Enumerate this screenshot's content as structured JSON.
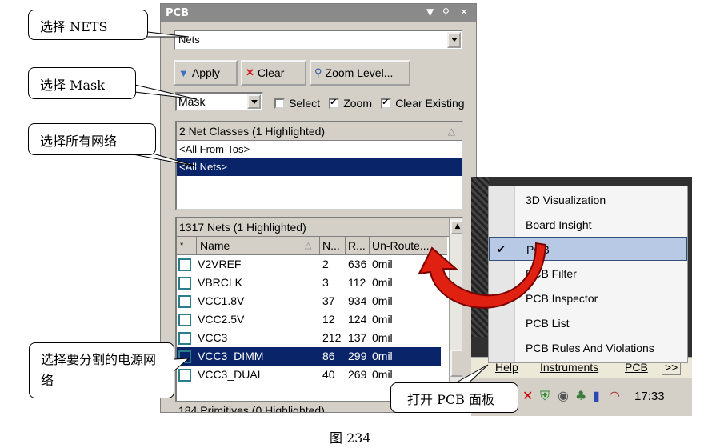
{
  "panel": {
    "title": "PCB",
    "title_controls": [
      "▼",
      "⚲",
      "✕"
    ],
    "scope_value": "Nets",
    "buttons": {
      "apply": "Apply",
      "clear": "Clear",
      "zoom_level": "Zoom Level..."
    },
    "mask_value": "Mask",
    "options": {
      "select": {
        "label": "Select",
        "checked": false
      },
      "zoom": {
        "label": "Zoom",
        "checked": true
      },
      "clear_existing": {
        "label": "Clear Existing",
        "checked": true
      }
    },
    "classes_header": "2 Net Classes (1 Highlighted)",
    "classes": [
      "<All From-Tos>",
      "<All Nets>"
    ],
    "nets_header": "1317 Nets (1 Highlighted)",
    "columns": [
      "*",
      "Name",
      "N...",
      "R...",
      "Un-Route..."
    ],
    "nets": [
      {
        "name": "V2VREF",
        "n": "2",
        "r": "636",
        "unrouted": "0mil"
      },
      {
        "name": "VBRCLK",
        "n": "3",
        "r": "112",
        "unrouted": "0mil"
      },
      {
        "name": "VCC1.8V",
        "n": "37",
        "r": "934",
        "unrouted": "0mil"
      },
      {
        "name": "VCC2.5V",
        "n": "12",
        "r": "124",
        "unrouted": "0mil"
      },
      {
        "name": "VCC3",
        "n": "212",
        "r": "137",
        "unrouted": "0mil"
      },
      {
        "name": "VCC3_DIMM",
        "n": "86",
        "r": "299",
        "unrouted": "0mil"
      },
      {
        "name": "VCC3_DUAL",
        "n": "40",
        "r": "269",
        "unrouted": "0mil"
      }
    ],
    "primitives_header": "184 Primitives (0 Highlighted)"
  },
  "callouts": {
    "nets": "选择 NETS",
    "mask": "选择 Mask",
    "all_nets": "选择所有网络",
    "power_net": "选择要分割的电源网络",
    "open_pcb": "打开 PCB 面板"
  },
  "menu": {
    "items": [
      "3D Visualization",
      "Board Insight",
      "PCB",
      "PCB Filter",
      "PCB Inspector",
      "PCB List",
      "PCB Rules And Violations"
    ],
    "checked_item": "PCB"
  },
  "taskbar": {
    "help": "Help",
    "instruments": "Instruments",
    "pcb": "PCB",
    "more": ">>",
    "clock": "17:33"
  },
  "caption": "图 234",
  "colors": {
    "selection": "#0a246a",
    "arrow": "#e02010",
    "panel_bg": "#d4d0c8"
  }
}
